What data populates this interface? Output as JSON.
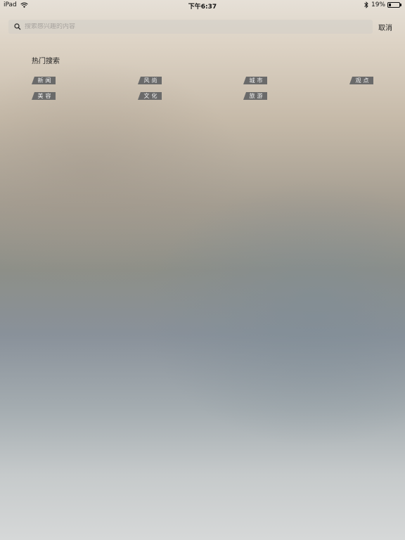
{
  "status_bar": {
    "device": "iPad",
    "time": "下午6:37",
    "battery": "19%",
    "battery_level": 0.19,
    "icons": [
      "wifi-icon",
      "bluetooth-icon",
      "battery-icon"
    ]
  },
  "search": {
    "placeholder": "搜索感兴趣的内容",
    "value": "",
    "icon": "search-icon",
    "cancel_label": "取消"
  },
  "hot_search": {
    "title": "热门搜索",
    "tags": [
      {
        "label": "新闻"
      },
      {
        "label": "风尚"
      },
      {
        "label": "城市"
      },
      {
        "label": "观点"
      },
      {
        "label": "美容"
      },
      {
        "label": "文化"
      },
      {
        "label": "旅游"
      }
    ]
  },
  "colors": {
    "tag_background": "#6a6a6a",
    "tag_text": "#f2f2f2"
  }
}
